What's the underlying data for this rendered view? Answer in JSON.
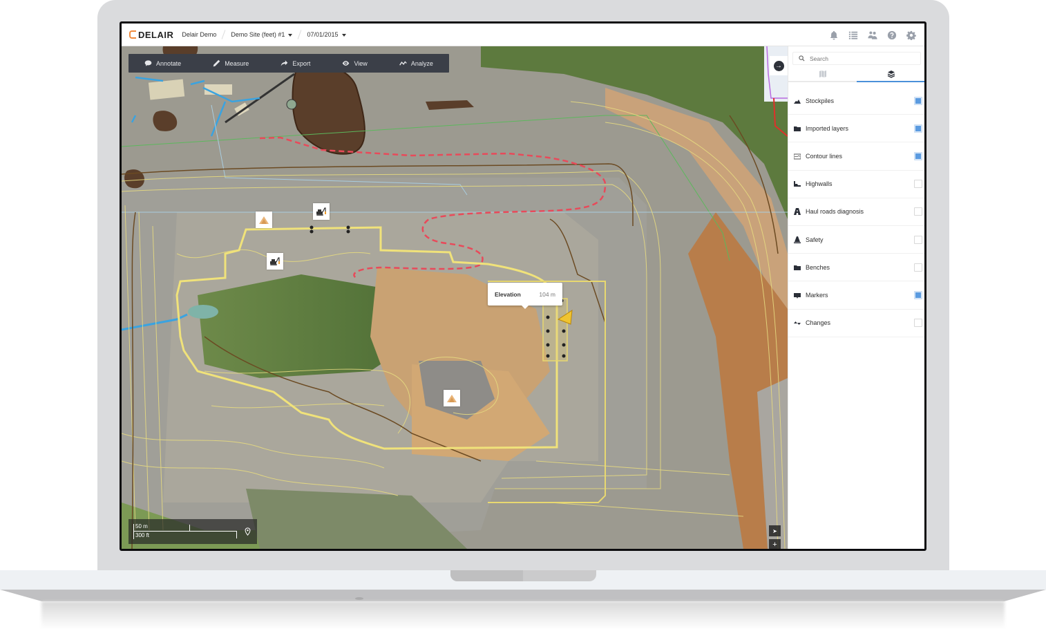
{
  "header": {
    "logo": "DELAIR",
    "breadcrumb": [
      {
        "label": "Delair Demo",
        "dropdown": false
      },
      {
        "label": "Demo Site (feet) #1",
        "dropdown": true
      },
      {
        "label": "07/01/2015",
        "dropdown": true
      }
    ],
    "icons": [
      "bell-icon",
      "list-icon",
      "users-icon",
      "help-icon",
      "settings-icon"
    ]
  },
  "toolbar": {
    "items": [
      {
        "label": "Annotate",
        "icon": "comment-icon"
      },
      {
        "label": "Measure",
        "icon": "ruler-icon"
      },
      {
        "label": "Export",
        "icon": "share-icon"
      },
      {
        "label": "View",
        "icon": "eye-icon"
      },
      {
        "label": "Analyze",
        "icon": "chart-line-icon"
      }
    ]
  },
  "map": {
    "tooltip": {
      "label": "Elevation",
      "value": "104 m"
    },
    "scale": {
      "metric": "50 m",
      "imperial": "300 ft"
    },
    "zoom_controls": {
      "locate": "➤",
      "zoom_in": "+",
      "zoom_out": "−"
    },
    "markers": [
      "stockpile-marker",
      "excavator-marker",
      "excavator-marker",
      "stockpile-marker",
      "blast-warning-marker"
    ],
    "colors": {
      "contour": "#e8dc7a",
      "boundary": "#6b4a22",
      "haul_road": "#e84a5a",
      "water": "#3aa3e0",
      "selection": "#f2e27a"
    }
  },
  "panel": {
    "search_placeholder": "Search",
    "tabs": [
      {
        "name": "map",
        "icon": "map-icon",
        "active": false
      },
      {
        "name": "layers",
        "icon": "layers-icon",
        "active": true
      }
    ],
    "layers": [
      {
        "label": "Stockpiles",
        "icon": "stockpile-icon",
        "checked": true
      },
      {
        "label": "Imported layers",
        "icon": "folder-icon",
        "checked": true
      },
      {
        "label": "Contour lines",
        "icon": "contour-icon",
        "checked": true
      },
      {
        "label": "Highwalls",
        "icon": "highwall-icon",
        "checked": false
      },
      {
        "label": "Haul roads diagnosis",
        "icon": "road-icon",
        "checked": false
      },
      {
        "label": "Safety",
        "icon": "cone-icon",
        "checked": false
      },
      {
        "label": "Benches",
        "icon": "folder-icon",
        "checked": false
      },
      {
        "label": "Markers",
        "icon": "marker-icon",
        "checked": true
      },
      {
        "label": "Changes",
        "icon": "changes-icon",
        "checked": false
      }
    ],
    "accent_color": "#4a90d9"
  }
}
